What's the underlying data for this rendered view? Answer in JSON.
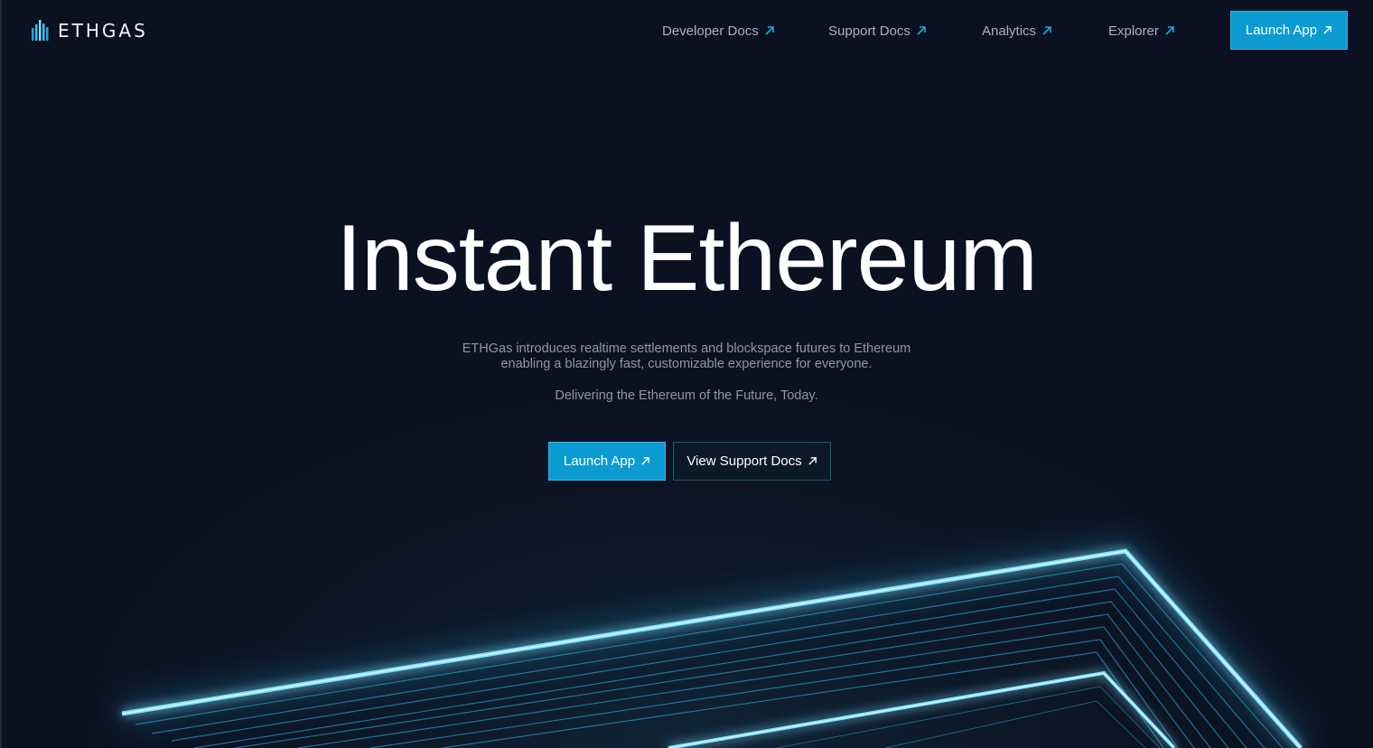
{
  "header": {
    "logo_text": "ETHGAS",
    "nav": [
      {
        "label": "Developer Docs",
        "icon": "arrow-up-right-icon"
      },
      {
        "label": "Support Docs",
        "icon": "arrow-up-right-icon"
      },
      {
        "label": "Analytics",
        "icon": "arrow-up-right-icon"
      },
      {
        "label": "Explorer",
        "icon": "arrow-up-right-icon"
      }
    ],
    "launch_button": {
      "label": "Launch App",
      "icon": "arrow-up-right-icon"
    }
  },
  "hero": {
    "title": "Instant Ethereum",
    "description_line1": "ETHGas introduces realtime settlements and blockspace futures to Ethereum",
    "description_line2": "enabling a blazingly fast, customizable experience for everyone.",
    "tagline": "Delivering the Ethereum of the Future, Today.",
    "primary_button": {
      "label": "Launch App",
      "icon": "arrow-up-right-icon"
    },
    "secondary_button": {
      "label": "View Support Docs",
      "icon": "arrow-up-right-icon"
    }
  },
  "colors": {
    "background": "#0b1120",
    "accent": "#0c9bd0",
    "nav_text": "#a8b2bf",
    "arrow_accent": "#1fa8dc",
    "glow": "#5fd4ff"
  }
}
